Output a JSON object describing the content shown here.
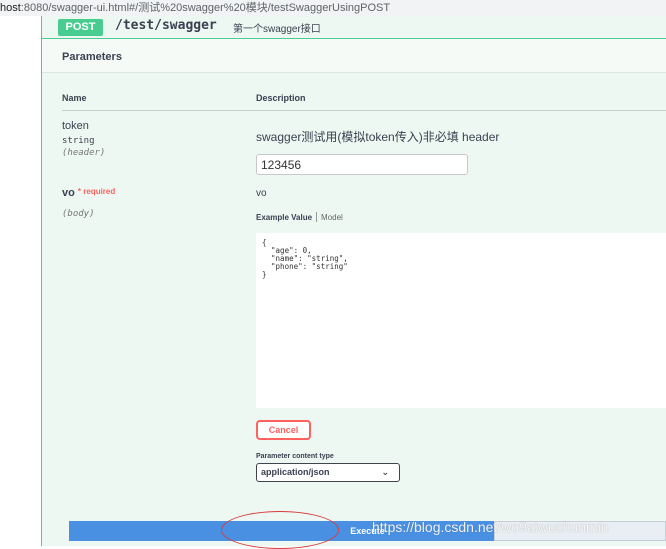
{
  "browser": {
    "host": "host",
    "url_rest": ":8080/swagger-ui.html#/测试%20swagger%20模块/testSwaggerUsingPOST"
  },
  "operation": {
    "method": "POST",
    "path": "/test/swagger",
    "summary": "第一个swagger接口"
  },
  "parameters_section": {
    "title": "Parameters",
    "col_name": "Name",
    "col_description": "Description"
  },
  "params": [
    {
      "name": "token",
      "type": "string",
      "location": "(header)",
      "description": "swagger测试用(模拟token传入)非必填 header",
      "value": "123456"
    },
    {
      "name": "vo",
      "required_mark": "* required",
      "location": "(body)",
      "description": "vo"
    }
  ],
  "body_tabs": {
    "active": "Example Value",
    "inactive": "Model"
  },
  "example_body": "{\n  \"age\": 0,\n  \"name\": \"string\",\n  \"phone\": \"string\"\n}",
  "buttons": {
    "cancel": "Cancel",
    "execute": "Execute"
  },
  "content_type": {
    "label": "Parameter content type",
    "selected": "application/json"
  },
  "watermark": "https://blog.csdn.net/wo9aiwuchunmin",
  "colors": {
    "post_green": "#49cc90",
    "execute_blue": "#4990e2",
    "cancel_red": "#ff6060"
  }
}
